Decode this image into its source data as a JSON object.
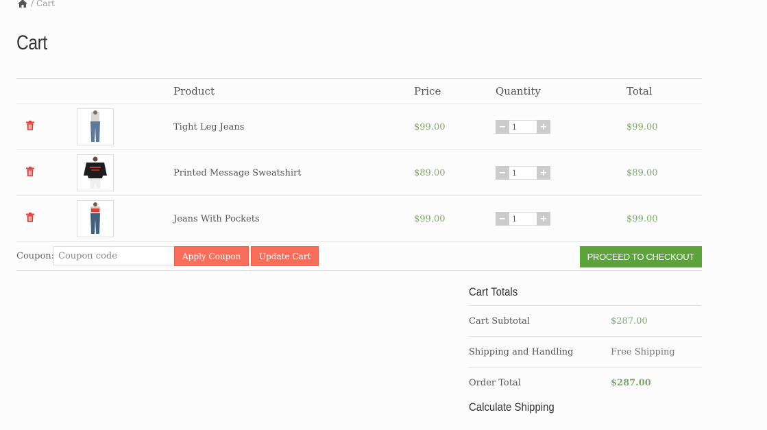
{
  "breadcrumb": {
    "separator": "/",
    "current": "Cart"
  },
  "page": {
    "title": "Cart"
  },
  "table": {
    "headers": {
      "product": "Product",
      "price": "Price",
      "quantity": "Quantity",
      "total": "Total"
    },
    "rows": [
      {
        "name": "Tight Leg Jeans",
        "price": "$99.00",
        "qty": "1",
        "total": "$99.00"
      },
      {
        "name": "Printed Message Sweatshirt",
        "price": "$89.00",
        "qty": "1",
        "total": "$89.00"
      },
      {
        "name": "Jeans With Pockets",
        "price": "$99.00",
        "qty": "1",
        "total": "$99.00"
      }
    ]
  },
  "qty_controls": {
    "minus": "−",
    "plus": "+"
  },
  "coupon": {
    "label": "Coupon:",
    "placeholder": "Coupon code",
    "apply_label": "Apply Coupon",
    "update_label": "Update Cart",
    "checkout_label": "PROCEED TO CHECKOUT"
  },
  "totals": {
    "title": "Cart Totals",
    "subtotal_label": "Cart Subtotal",
    "subtotal_value": "$287.00",
    "shipping_label": "Shipping and Handling",
    "shipping_value": "Free Shipping",
    "order_total_label": "Order Total",
    "order_total_value": "$287.00",
    "calc_shipping_title": "Calculate Shipping"
  },
  "colors": {
    "accent_green": "#5aa43b",
    "price_green": "#7fa76b",
    "button_orange": "#f96e5b",
    "remove_red": "#e53935"
  }
}
